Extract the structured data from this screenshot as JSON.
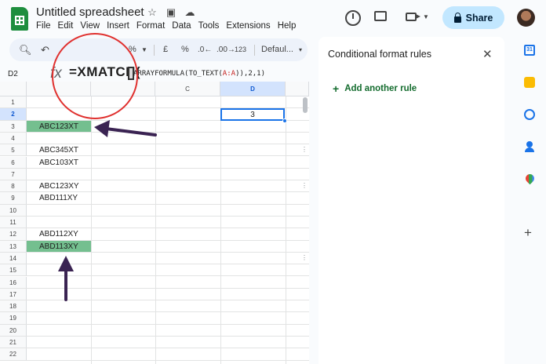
{
  "header": {
    "doc_title": "Untitled spreadsheet",
    "menu": [
      "File",
      "Edit",
      "View",
      "Insert",
      "Format",
      "Data",
      "Tools",
      "Extensions",
      "Help"
    ],
    "share_label": "Share"
  },
  "toolbar": {
    "percent_left": "%",
    "currency": "£",
    "percent": "%",
    "dec_decrease": ".0",
    "dec_increase": ".00",
    "number_format": "123",
    "font": "Defaul..."
  },
  "formula_bar": {
    "cell_ref": "D2",
    "fx": "fx",
    "formula_highlight": "=XMATCH(",
    "formula_part1": "ARRAYFORMULA(TO_TEXT(",
    "formula_ref": "A:A",
    "formula_part2": ")),2,1)"
  },
  "sheet": {
    "columns": [
      "C",
      "D"
    ],
    "rows": [
      {
        "n": "1",
        "a": ""
      },
      {
        "n": "2",
        "a": ""
      },
      {
        "n": "3",
        "a": "ABC123XT"
      },
      {
        "n": "4",
        "a": ""
      },
      {
        "n": "5",
        "a": "ABC345XT"
      },
      {
        "n": "6",
        "a": "ABC103XT"
      },
      {
        "n": "7",
        "a": ""
      },
      {
        "n": "8",
        "a": "ABC123XY"
      },
      {
        "n": "9",
        "a": "ABD111XY"
      },
      {
        "n": "10",
        "a": ""
      },
      {
        "n": "11",
        "a": ""
      },
      {
        "n": "12",
        "a": "ABD112XY"
      },
      {
        "n": "13",
        "a": "ABD113XY"
      },
      {
        "n": "14",
        "a": ""
      },
      {
        "n": "15",
        "a": ""
      },
      {
        "n": "16",
        "a": ""
      },
      {
        "n": "17",
        "a": ""
      },
      {
        "n": "18",
        "a": ""
      },
      {
        "n": "19",
        "a": ""
      },
      {
        "n": "20",
        "a": ""
      },
      {
        "n": "21",
        "a": ""
      },
      {
        "n": "22",
        "a": ""
      }
    ],
    "highlighted_rows": [
      "3",
      "13"
    ],
    "d2_value": "3",
    "highlight_color": "#74bf8f",
    "selection_color": "#1a73e8"
  },
  "panel": {
    "title": "Conditional format rules",
    "add_rule_label": "Add another rule",
    "accent_color": "#146c2e"
  },
  "side_icons": [
    "calendar-icon",
    "keep-icon",
    "tasks-icon",
    "contacts-icon",
    "maps-icon",
    "plus-icon"
  ],
  "side_calendar_text": "31"
}
